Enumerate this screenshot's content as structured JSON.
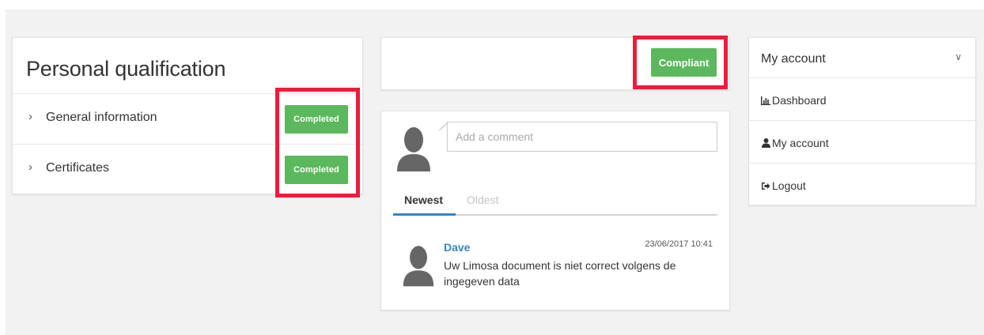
{
  "qualification": {
    "title": "Personal qualification",
    "rows": [
      {
        "label": "General information",
        "status": "Completed"
      },
      {
        "label": "Certificates",
        "status": "Completed"
      }
    ]
  },
  "status": {
    "button_label": "Compliant"
  },
  "comments": {
    "placeholder": "Add a comment",
    "tabs": [
      "Newest",
      "Oldest"
    ],
    "items": [
      {
        "author": "Dave",
        "timestamp": "23/06/2017 10:41",
        "text": "Uw Limosa document is niet correct volgens de ingegeven data"
      }
    ]
  },
  "account": {
    "title": "My account",
    "items": [
      {
        "label": "Dashboard",
        "icon": "bar-chart-icon"
      },
      {
        "label": "My account",
        "icon": "user-icon"
      },
      {
        "label": "Logout",
        "icon": "logout-icon"
      }
    ]
  },
  "colors": {
    "success": "#5cb85c",
    "highlight": "#ee1c3c",
    "link": "#3a83c0"
  }
}
